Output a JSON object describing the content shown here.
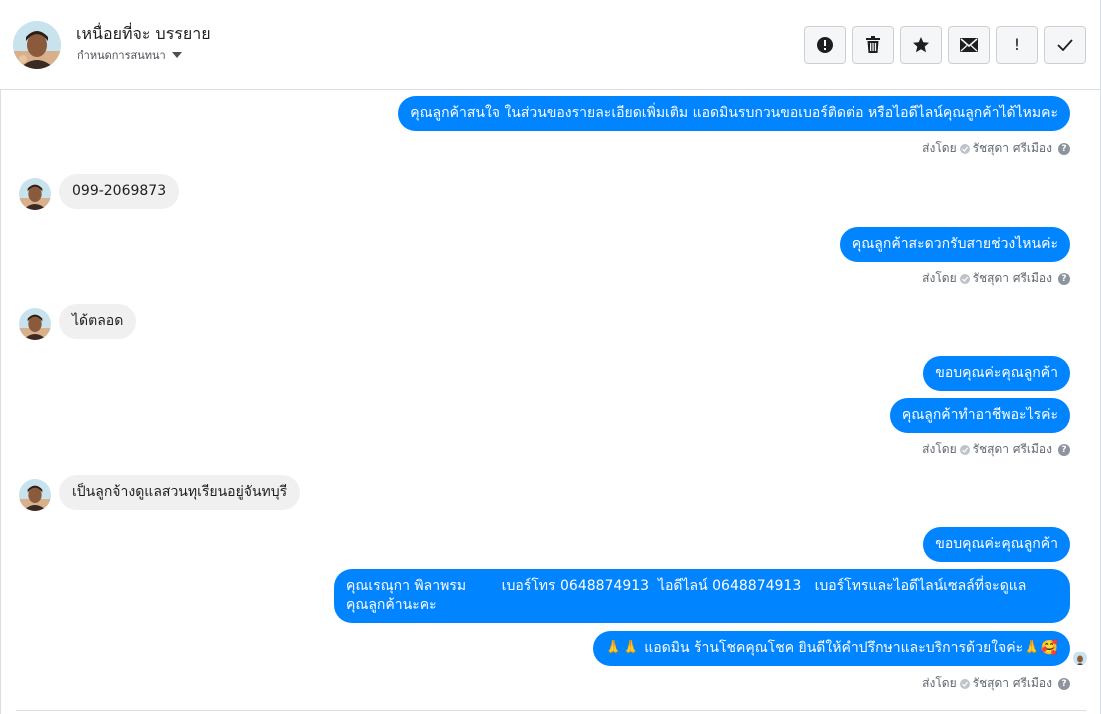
{
  "header": {
    "name": "เหนื่อยที่จะ บรรยาย",
    "subtitle": "กำหนดการสนทนา",
    "toolbar": [
      {
        "name": "spam-icon",
        "glyph": "!"
      },
      {
        "name": "trash-icon"
      },
      {
        "name": "star-icon"
      },
      {
        "name": "envelope-icon"
      },
      {
        "name": "exclamation-icon",
        "glyph": "!"
      },
      {
        "name": "checkmark-icon"
      }
    ]
  },
  "sent_by": {
    "prefix": "ส่งโดย",
    "agent": "รัชสุดา ศรีเมือง",
    "help": "?"
  },
  "messages": {
    "m1": "คุณลูกค้าสนใจ ในส่วนของรายละเอียดเพิ่มเติม แอดมินรบกวนขอเบอร์ติดต่อ หรือไอดีไลน์คุณลูกค้าได้ไหมคะ",
    "m2": "099-2069873",
    "m3": "คุณลูกค้าสะดวกรับสายช่วงไหนค่ะ",
    "m4": "ได้ตลอด",
    "m5": "ขอบคุณค่ะคุณลูกค้า",
    "m6": "คุณลูกค้าทำอาชีพอะไรค่ะ",
    "m7": "เป็นลูกจ้างดูแลสวนทุเรียนอยู่จันทบุรี",
    "m8": "ขอบคุณค่ะคุณลูกค้า",
    "m9_line1": "คุณเรณุกา พิลาพรม        เบอร์โทร 0648874913  ไอดีไลน์ 0648874913   เบอร์โทรและไอดีไลน์เซลล์ที่จะดูแล",
    "m9_line2": "คุณลูกค้านะคะ",
    "m10_emoji_start": "🙏🙏",
    "m10_text": "แอดมิน ร้านโชคคุณโชค ยินดีให้คำปรึกษาและบริการด้วยใจค่ะ",
    "m10_emoji_end": "🙏🥰"
  },
  "colors": {
    "outgoing": "#0084ff",
    "incoming": "#f1f0f0",
    "border": "#dadde1"
  }
}
